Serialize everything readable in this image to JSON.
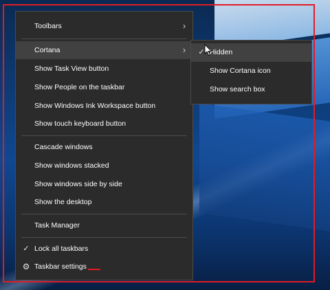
{
  "context_menu": {
    "items": [
      {
        "label": "Toolbars",
        "has_submenu": true
      },
      {
        "label": "Cortana",
        "has_submenu": true,
        "highlighted": true
      },
      {
        "label": "Show Task View button"
      },
      {
        "label": "Show People on the taskbar"
      },
      {
        "label": "Show Windows Ink Workspace button"
      },
      {
        "label": "Show touch keyboard button"
      },
      {
        "label": "Cascade windows"
      },
      {
        "label": "Show windows stacked"
      },
      {
        "label": "Show windows side by side"
      },
      {
        "label": "Show the desktop"
      },
      {
        "label": "Task Manager"
      },
      {
        "label": "Lock all taskbars",
        "checked": true
      },
      {
        "label": "Taskbar settings",
        "icon": "gear-icon"
      }
    ],
    "chevron_glyph": "›",
    "check_glyph": "✓",
    "gear_glyph": "⚙"
  },
  "cortana_submenu": {
    "items": [
      {
        "label": "Hidden",
        "checked": true,
        "highlighted": true
      },
      {
        "label": "Show Cortana icon"
      },
      {
        "label": "Show search box"
      }
    ]
  },
  "colors": {
    "menu_bg": "#2b2b2b",
    "highlight_bg": "#414141",
    "annotation_red": "#e21b24",
    "desktop_blue": "#0f4891"
  }
}
